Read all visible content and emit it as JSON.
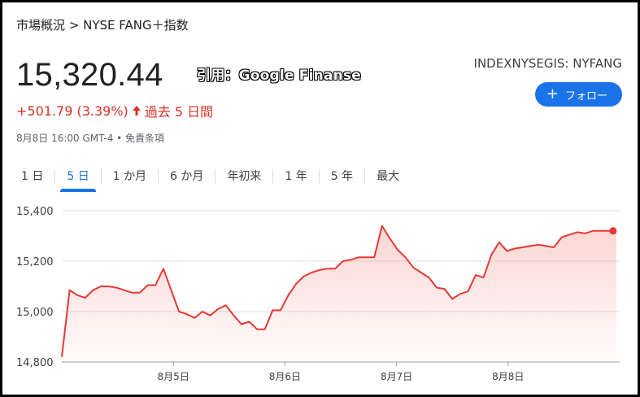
{
  "breadcrumb": "市場概況 > NYSE FANG＋指数",
  "price": "15,320.44",
  "credit": "引用：Google Finanse",
  "ticker": "INDEXNYSEGIS: NYFANG",
  "follow_label": "フォロー",
  "change": {
    "text": "+501.79 (3.39%)",
    "period": "過去 5 日間",
    "color": "#d93025"
  },
  "timestamp": "8月8日 16:00 GMT-4 • 免責条項",
  "tabs": [
    {
      "label": "1 日",
      "active": false
    },
    {
      "label": "5 日",
      "active": true
    },
    {
      "label": "1 か月",
      "active": false
    },
    {
      "label": "6 か月",
      "active": false
    },
    {
      "label": "年初来",
      "active": false
    },
    {
      "label": "1 年",
      "active": false
    },
    {
      "label": "5 年",
      "active": false
    },
    {
      "label": "最大",
      "active": false
    }
  ],
  "chart_data": {
    "type": "area",
    "ylim": [
      14800,
      15400
    ],
    "yticks": [
      14800,
      15000,
      15200,
      15400
    ],
    "ytick_labels": [
      "14,800",
      "15,000",
      "15,200",
      "15,400"
    ],
    "xlim": [
      0,
      5
    ],
    "xticks": [
      1,
      2,
      3,
      4
    ],
    "xtick_labels": [
      "8月5日",
      "8月6日",
      "8月7日",
      "8月8日"
    ],
    "line_color": "#e53935",
    "x": [
      0.0,
      0.07,
      0.14,
      0.21,
      0.28,
      0.35,
      0.42,
      0.49,
      0.56,
      0.63,
      0.7,
      0.77,
      0.84,
      0.91,
      0.98,
      1.05,
      1.12,
      1.19,
      1.26,
      1.33,
      1.4,
      1.47,
      1.54,
      1.61,
      1.68,
      1.75,
      1.82,
      1.89,
      1.96,
      2.03,
      2.1,
      2.17,
      2.24,
      2.31,
      2.38,
      2.45,
      2.52,
      2.59,
      2.66,
      2.73,
      2.8,
      2.87,
      2.94,
      3.01,
      3.08,
      3.15,
      3.22,
      3.29,
      3.36,
      3.43,
      3.5,
      3.57,
      3.64,
      3.71,
      3.78,
      3.85,
      3.92,
      3.99,
      4.06,
      4.13,
      4.2,
      4.27,
      4.34,
      4.41,
      4.48,
      4.55,
      4.62,
      4.69,
      4.76,
      4.83,
      4.9,
      4.97
    ],
    "values": [
      14820,
      15085,
      15065,
      15055,
      15085,
      15100,
      15100,
      15095,
      15085,
      15075,
      15075,
      15105,
      15105,
      15170,
      15085,
      15000,
      14990,
      14975,
      15000,
      14985,
      15010,
      15025,
      14985,
      14950,
      14960,
      14930,
      14930,
      15005,
      15005,
      15065,
      15110,
      15140,
      15155,
      15165,
      15170,
      15170,
      15200,
      15205,
      15215,
      15215,
      15215,
      15340,
      15290,
      15245,
      15215,
      15175,
      15155,
      15135,
      15095,
      15090,
      15050,
      15070,
      15080,
      15145,
      15135,
      15225,
      15275,
      15240,
      15250,
      15255,
      15260,
      15265,
      15260,
      15255,
      15295,
      15305,
      15315,
      15310,
      15320,
      15320,
      15320,
      15320
    ]
  }
}
